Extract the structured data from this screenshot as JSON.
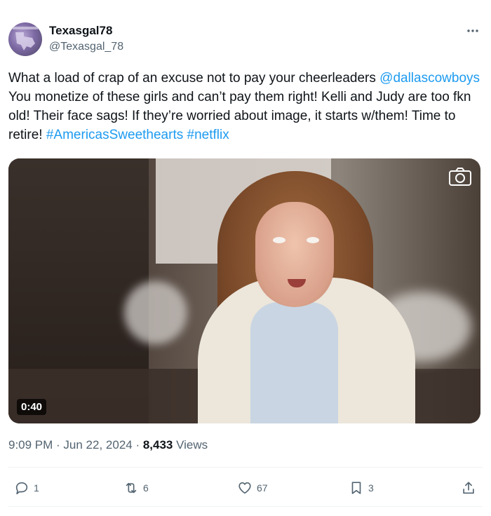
{
  "author": {
    "display_name": "Texasgal78",
    "handle": "@Texasgal_78",
    "avatar_icon": "texas-flag-avatar-icon"
  },
  "tweet": {
    "text_part1": "What a load of crap of an excuse not to pay your cheerleaders ",
    "mention": "@dallascowboys",
    "text_part2": " You monetize of these girls and can’t pay them right! Kelli and Judy are too fkn old! Their face sags! If they’re worried about image, it starts w/them! Time to retire! ",
    "hashtag1": "#AmericasSweethearts",
    "space": " ",
    "hashtag2": "#netflix"
  },
  "media": {
    "duration": "0:40",
    "icon": "camera-icon"
  },
  "meta": {
    "time": "9:09 PM",
    "sep1": " · ",
    "date": "Jun 22, 2024",
    "sep2": " · ",
    "views": "8,433",
    "views_label": " Views"
  },
  "actions": {
    "replies": "1",
    "retweets": "6",
    "likes": "67",
    "bookmarks": "3"
  },
  "colors": {
    "link": "#1d9bf0",
    "secondary_text": "#536471",
    "primary_text": "#0f1419"
  }
}
